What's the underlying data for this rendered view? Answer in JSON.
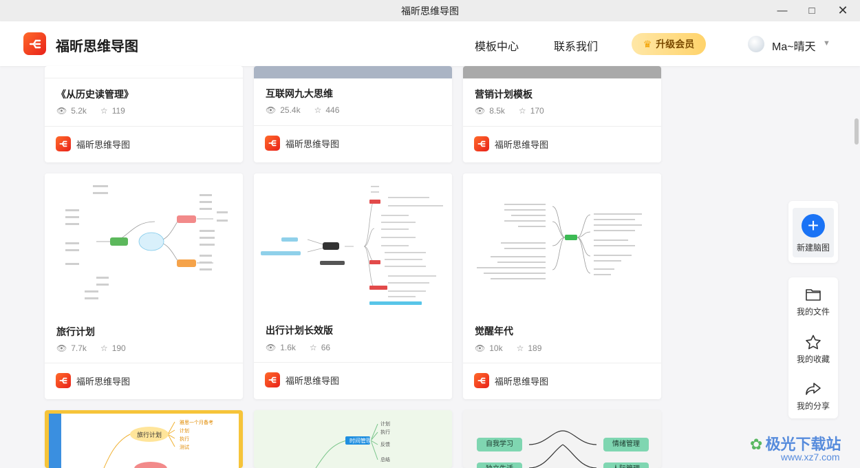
{
  "window": {
    "title": "福昕思维导图"
  },
  "header": {
    "app_name": "福昕思维导图",
    "nav": [
      "模板中心",
      "联系我们"
    ],
    "vip_label": "升级会员",
    "username": "Ma~晴天"
  },
  "cards": [
    {
      "title": "《从历史读管理》",
      "views": "5.2k",
      "stars": "119",
      "author": "福昕思维导图"
    },
    {
      "title": "互联网九大思维",
      "views": "25.4k",
      "stars": "446",
      "author": "福昕思维导图"
    },
    {
      "title": "营销计划模板",
      "views": "8.5k",
      "stars": "170",
      "author": "福昕思维导图"
    },
    {
      "title": "旅行计划",
      "views": "7.7k",
      "stars": "190",
      "author": "福昕思维导图"
    },
    {
      "title": "出行计划长效版",
      "views": "1.6k",
      "stars": "66",
      "author": "福昕思维导图"
    },
    {
      "title": "觉醒年代",
      "views": "10k",
      "stars": "189",
      "author": "福昕思维导图"
    }
  ],
  "bottom_row": {
    "c1": {
      "center": "旅行计划",
      "items": [
        "雅思一个月备考",
        "计划",
        "执行",
        "测试"
      ]
    },
    "c2": {
      "center": "时间管理",
      "items": [
        "计划",
        "执行",
        "反馈",
        "总结"
      ]
    },
    "c3": {
      "left": [
        "自我学习",
        "独立生活"
      ],
      "right": [
        "情绪管理",
        "人际管理"
      ]
    }
  },
  "sidebar": {
    "new_label": "新建脑图",
    "files_label": "我的文件",
    "fav_label": "我的收藏",
    "share_label": "我的分享"
  },
  "watermark": {
    "brand": "极光下载站",
    "url": "www.xz7.com"
  }
}
